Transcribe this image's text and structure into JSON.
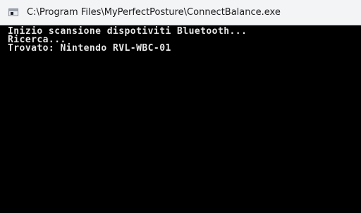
{
  "window": {
    "title": "C:\\Program Files\\MyPerfectPosture\\ConnectBalance.exe",
    "icon": "console-app-icon"
  },
  "console": {
    "lines": [
      "Inizio scansione dispotiviti Bluetooth...",
      "Ricerca...",
      "Trovato: Nintendo RVL-WBC-01"
    ]
  }
}
